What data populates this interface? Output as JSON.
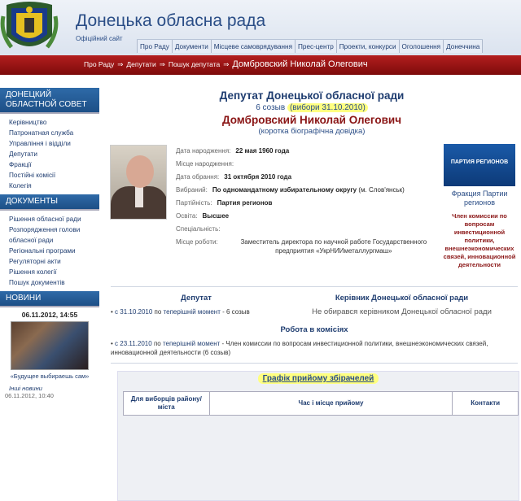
{
  "site": {
    "title": "Донецька обласна рада",
    "subtitle": "Офіційний сайт"
  },
  "topnav": [
    "Про Раду",
    "Документи",
    "Місцеве самоврядування",
    "Прес-центр",
    "Проекти, конкурси",
    "Оголошення",
    "Донеччина"
  ],
  "breadcrumb": {
    "items": [
      "Про Раду",
      "Депутати",
      "Пошук депутата"
    ],
    "separator": "⇒",
    "current": "Домбровский Николай Олегович"
  },
  "sidebar": {
    "council_heading": "ДОНЕЦКИЙ ОБЛАСТНОЙ СОВЕТ",
    "council_items": [
      "Керівництво",
      "Патронатная служба",
      "Управління і відділи",
      "Депутати",
      "Фракції",
      "Постійні комісії",
      "Колегія"
    ],
    "docs_heading": "ДОКУМЕНТЫ",
    "docs_items": [
      "Рішення обласної ради",
      "Розпорядження голови обласної ради",
      "Регіональні програми",
      "Регуляторні акти",
      "Рішення колегії",
      "Пошук документів"
    ],
    "news_heading": "НОВИНИ",
    "news_date": "06.11.2012, 14:55",
    "news_caption": "«Будущее выбираешь сам»",
    "news_more": "Інші новини",
    "news_date2": "06.11.2012, 10:40"
  },
  "deputy": {
    "heading": "Депутат Донецької обласної ради",
    "convocation": "6 созыв",
    "elections": "(вибори 31.10.2010)",
    "name": "Домбровский Николай Олегович",
    "short_bio": "(коротка біографічна довідка)",
    "fields": [
      {
        "label": "Дата народження:",
        "value": "22 мая 1960 года",
        "bold": true
      },
      {
        "label": "Місце народження:",
        "value": "",
        "bold": true
      },
      {
        "label": "Дата обрання:",
        "value": "31 октября 2010 года",
        "bold": true
      },
      {
        "label": "Вибраний:",
        "value": "По одномандатному избирательному округу",
        "extra": "(м. Слов'янськ)",
        "bold": true
      },
      {
        "label": "Партійність:",
        "value": "Партия регионов",
        "bold": true
      },
      {
        "label": "Освіта:",
        "value": "Высшее",
        "bold": true
      },
      {
        "label": "Спеціальність:",
        "value": "",
        "bold": true
      },
      {
        "label": "Місце роботи:",
        "value": "Заместитель директора по научной работе Государственного предприятия «УкрНИИметаллургмаш»",
        "bold": false
      }
    ],
    "party_logo_text": "ПАРТИЯ РЕГИОНОВ",
    "faction": "Фракция Партии регионов",
    "commission": "Член комиссии по вопросам инвестиционной политики, внешнеэкономических связей, инновационной деятельности"
  },
  "sections": {
    "deputy_title": "Депутат",
    "deputy_item": {
      "from": "с 31.10.2010",
      "mid": "по",
      "link": "теперішній момент",
      "tail": "- 6 созыв"
    },
    "leader_title": "Керівник Донецької обласної ради",
    "leader_text": "Не обирався керівником Донецької обласної ради",
    "work_title": "Робота в комісіях",
    "work_item": {
      "from": "с 23.11.2010",
      "mid": "по",
      "link": "теперішній момент",
      "tail": "- Член комиссии по вопросам инвестиционной политики, внешнеэкономических связей, инновационной деятельности (6 созыв)"
    }
  },
  "schedule": {
    "title": "Графік прийому збірачелей",
    "columns": [
      "Для виборців району/міста",
      "Час і місце прийому",
      "Контакти"
    ]
  }
}
